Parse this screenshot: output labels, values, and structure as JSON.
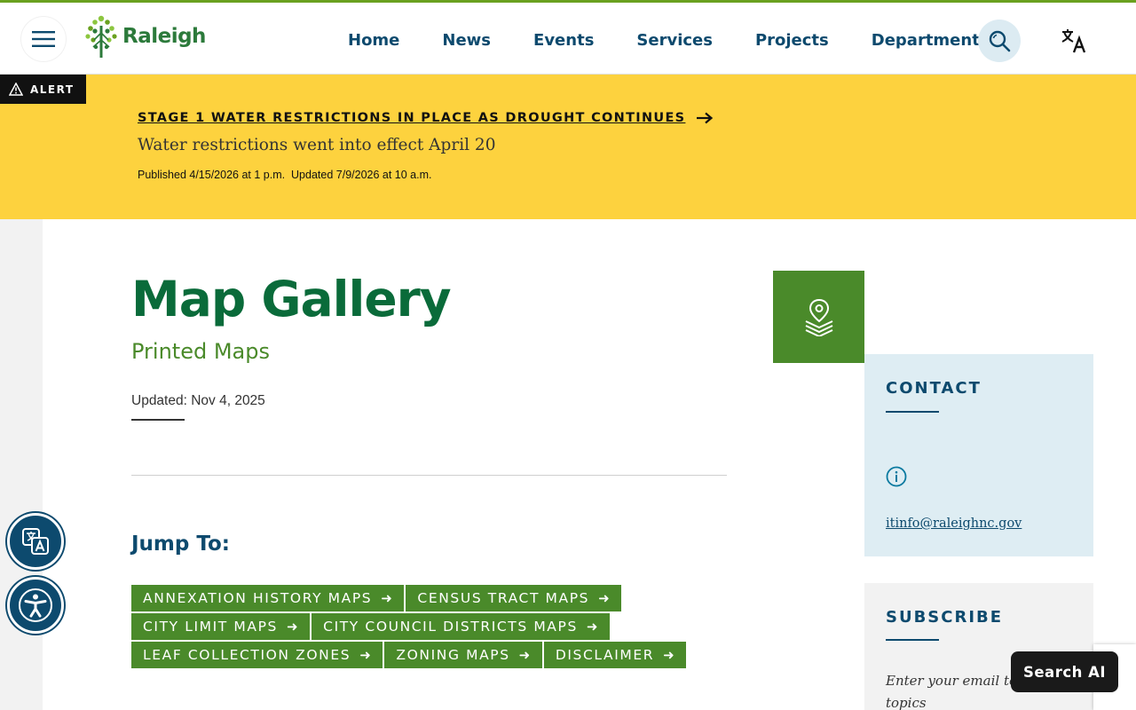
{
  "header": {
    "logo_text": "Raleigh",
    "nav": [
      "Home",
      "News",
      "Events",
      "Services",
      "Projects",
      "Departments"
    ]
  },
  "alert": {
    "tag": "ALERT",
    "title": "STAGE 1 WATER RESTRICTIONS IN PLACE AS DROUGHT CONTINUES",
    "subtitle": "Water restrictions went into effect April 20",
    "meta": "Published 4/15/2026 at 1 p.m.  Updated 7/9/2026 at 10 a.m."
  },
  "page": {
    "title": "Map Gallery",
    "subtitle": "Printed Maps",
    "updated": "Updated: Nov 4, 2025",
    "jump_label": "Jump To:",
    "jump_links": [
      "ANNEXATION HISTORY MAPS",
      "CENSUS TRACT MAPS",
      "CITY LIMIT MAPS",
      "CITY COUNCIL DISTRICTS MAPS",
      "LEAF COLLECTION ZONES",
      "ZONING MAPS",
      "DISCLAIMER"
    ]
  },
  "sidebar": {
    "contact_heading": "CONTACT",
    "contact_email": "itinfo@raleighnc.gov",
    "subscribe_heading": "SUBSCRIBE",
    "subscribe_text": "Enter your email to v... topics"
  },
  "widgets": {
    "search_ai": "Search AI"
  },
  "colors": {
    "brand_green": "#4a8a2a",
    "title_green": "#0a6b3a",
    "navy": "#0d4a6e",
    "alert_yellow": "#fdd23e"
  }
}
